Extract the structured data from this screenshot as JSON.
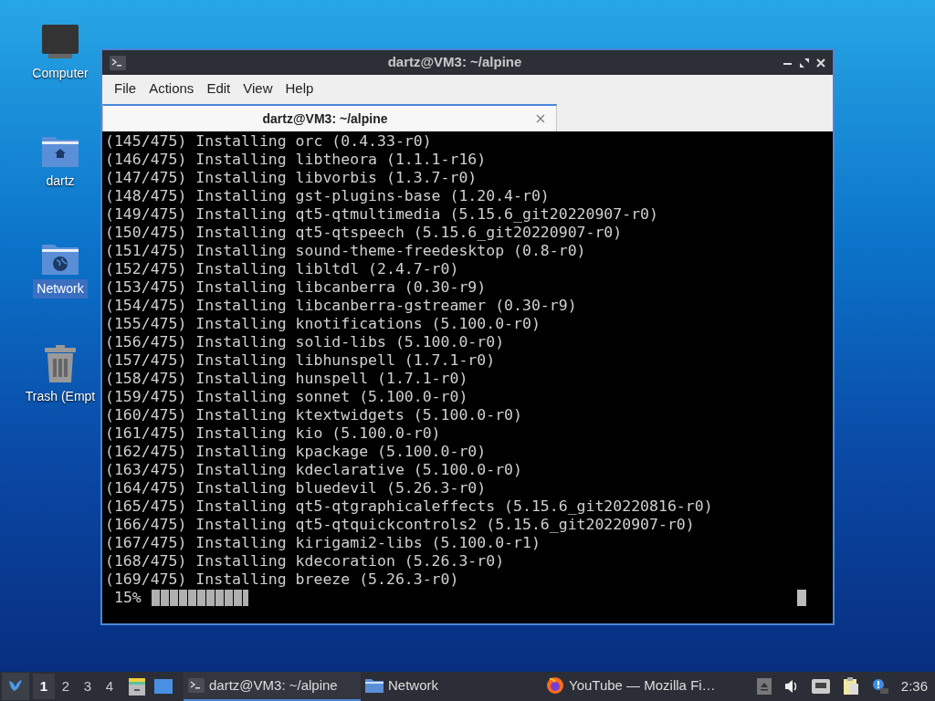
{
  "desktop_icons": [
    {
      "kind": "computer",
      "label": "Computer",
      "selected": false
    },
    {
      "kind": "home",
      "label": "dartz",
      "selected": false
    },
    {
      "kind": "network",
      "label": "Network",
      "selected": true
    },
    {
      "kind": "trash",
      "label": "Trash (Empt",
      "selected": false
    }
  ],
  "window": {
    "title": "dartz@VM3: ~/alpine",
    "menu": [
      "File",
      "Actions",
      "Edit",
      "View",
      "Help"
    ],
    "tabs": [
      {
        "label": "dartz@VM3: ~/alpine",
        "selected": true
      }
    ],
    "terminal": {
      "lines": [
        "(145/475) Installing orc (0.4.33-r0)",
        "(146/475) Installing libtheora (1.1.1-r16)",
        "(147/475) Installing libvorbis (1.3.7-r0)",
        "(148/475) Installing gst-plugins-base (1.20.4-r0)",
        "(149/475) Installing qt5-qtmultimedia (5.15.6_git20220907-r0)",
        "(150/475) Installing qt5-qtspeech (5.15.6_git20220907-r0)",
        "(151/475) Installing sound-theme-freedesktop (0.8-r0)",
        "(152/475) Installing libltdl (2.4.7-r0)",
        "(153/475) Installing libcanberra (0.30-r9)",
        "(154/475) Installing libcanberra-gstreamer (0.30-r9)",
        "(155/475) Installing knotifications (5.100.0-r0)",
        "(156/475) Installing solid-libs (5.100.0-r0)",
        "(157/475) Installing libhunspell (1.7.1-r0)",
        "(158/475) Installing hunspell (1.7.1-r0)",
        "(159/475) Installing sonnet (5.100.0-r0)",
        "(160/475) Installing ktextwidgets (5.100.0-r0)",
        "(161/475) Installing kio (5.100.0-r0)",
        "(162/475) Installing kpackage (5.100.0-r0)",
        "(163/475) Installing kdeclarative (5.100.0-r0)",
        "(164/475) Installing bluedevil (5.26.3-r0)",
        "(165/475) Installing qt5-qtgraphicaleffects (5.15.6_git20220816-r0)",
        "(166/475) Installing qt5-qtquickcontrols2 (5.15.6_git20220907-r0)",
        "(167/475) Installing kirigami2-libs (5.100.0-r1)",
        "(168/475) Installing kdecoration (5.26.3-r0)",
        "(169/475) Installing breeze (5.26.3-r0)"
      ],
      "progress": {
        "reading": "15%",
        "level": 0.15
      }
    }
  },
  "taskbar": {
    "workspaces": [
      {
        "label": "1",
        "selected": true
      },
      {
        "label": "2",
        "selected": false
      },
      {
        "label": "3",
        "selected": false
      },
      {
        "label": "4",
        "selected": false
      }
    ],
    "tasks": [
      {
        "kind": "terminal",
        "label": "dartz@VM3: ~/alpine",
        "selected": true
      },
      {
        "kind": "folder",
        "label": "Network",
        "selected": false
      },
      {
        "kind": "browser",
        "label": "YouTube — Mozilla Fi…",
        "selected": false
      }
    ],
    "clock": "2:36"
  }
}
